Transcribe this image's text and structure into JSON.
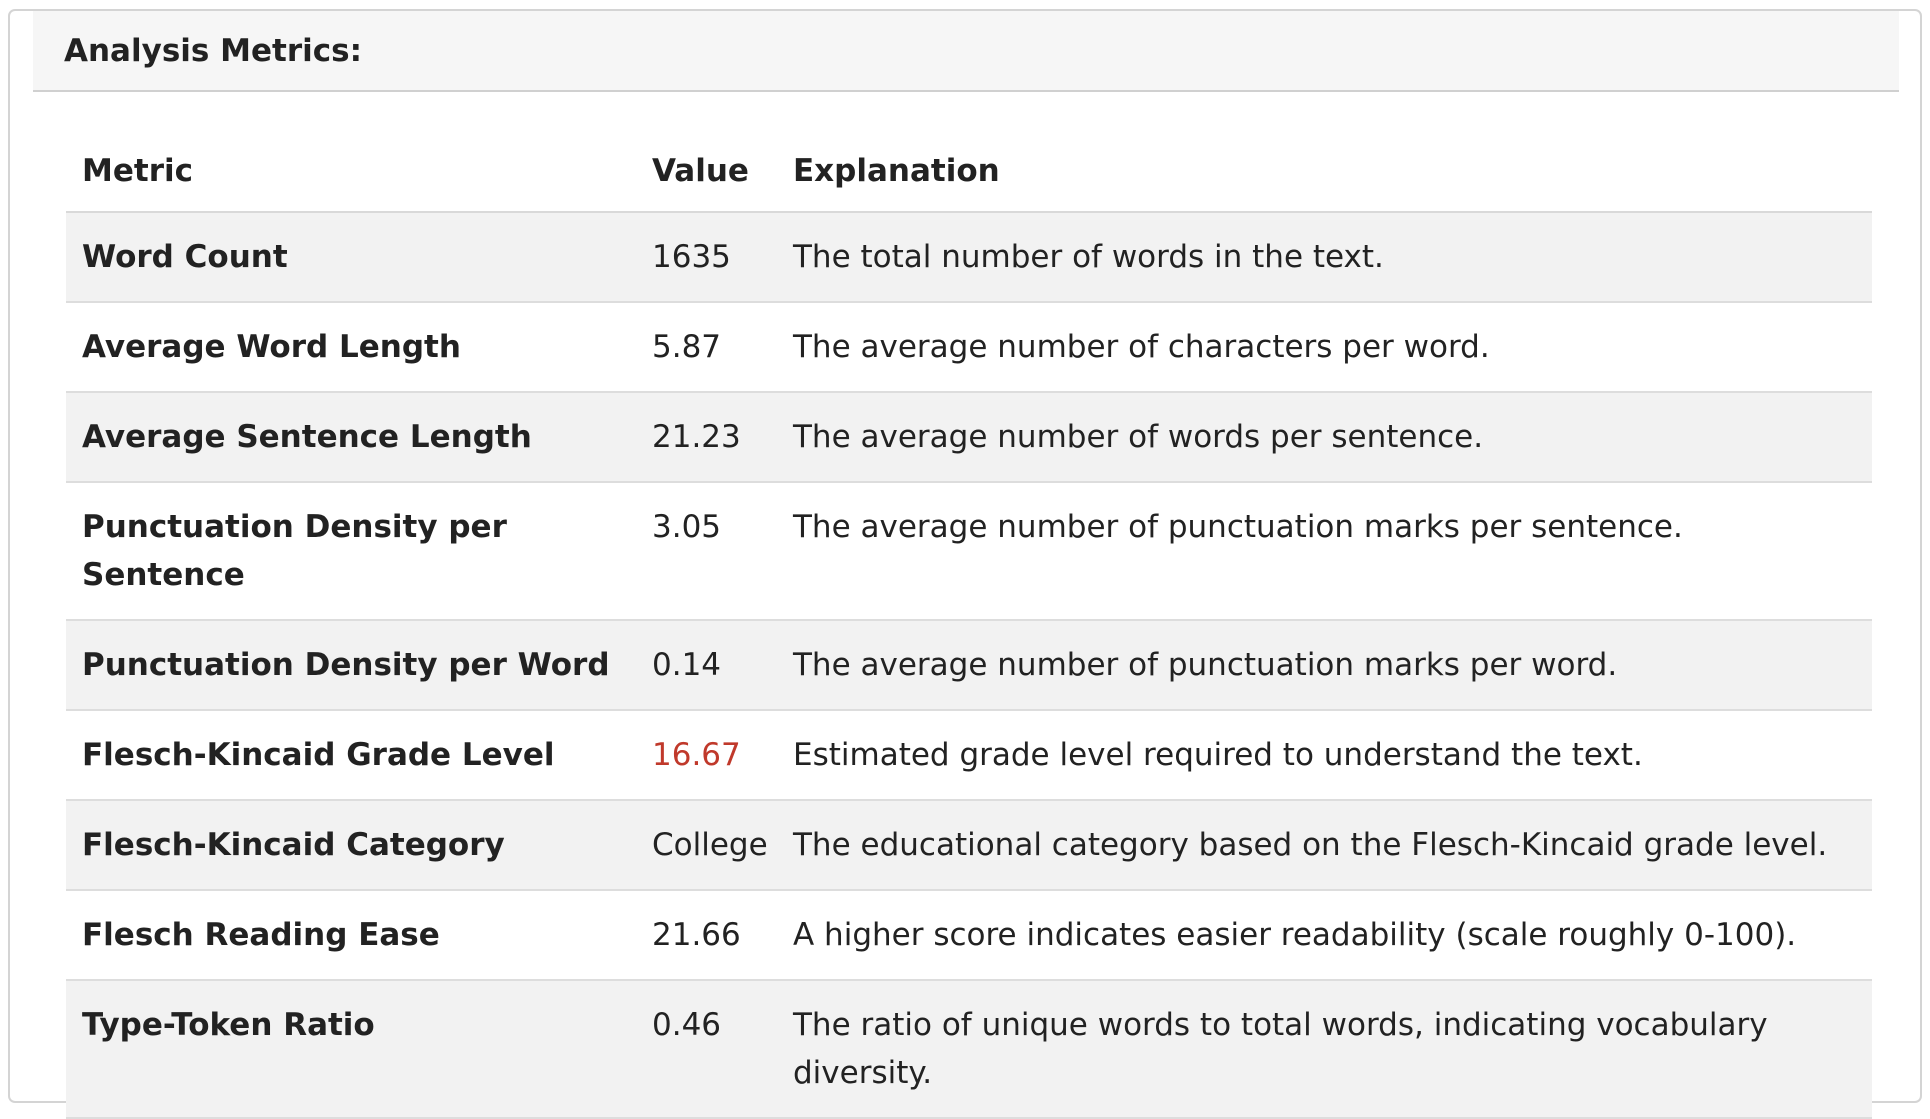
{
  "panel": {
    "title": "Analysis Metrics:"
  },
  "table": {
    "headers": {
      "metric": "Metric",
      "value": "Value",
      "explanation": "Explanation"
    },
    "rows": [
      {
        "metric": "Word Count",
        "value": "1635",
        "explanation": "The total number of words in the text."
      },
      {
        "metric": "Average Word Length",
        "value": "5.87",
        "explanation": "The average number of characters per word."
      },
      {
        "metric": "Average Sentence Length",
        "value": "21.23",
        "explanation": "The average number of words per sentence."
      },
      {
        "metric": "Punctuation Density per Sentence",
        "value": "3.05",
        "explanation": "The average number of punctuation marks per sentence."
      },
      {
        "metric": "Punctuation Density per Word",
        "value": "0.14",
        "explanation": "The average number of punctuation marks per word."
      },
      {
        "metric": "Flesch-Kincaid Grade Level",
        "value": "16.67",
        "explanation": "Estimated grade level required to understand the text."
      },
      {
        "metric": "Flesch-Kincaid Category",
        "value": "College",
        "explanation": "The educational category based on the Flesch-Kincaid grade level."
      },
      {
        "metric": "Flesch Reading Ease",
        "value": "21.66",
        "explanation": "A higher score indicates easier readability (scale roughly 0-100)."
      },
      {
        "metric": "Type-Token Ratio",
        "value": "0.46",
        "explanation": "The ratio of unique words to total words, indicating vocabulary diversity."
      }
    ]
  },
  "colors": {
    "highlight_value": "#c0392b",
    "stripe": "#f2f2f2",
    "header_bg": "#f6f6f6"
  }
}
